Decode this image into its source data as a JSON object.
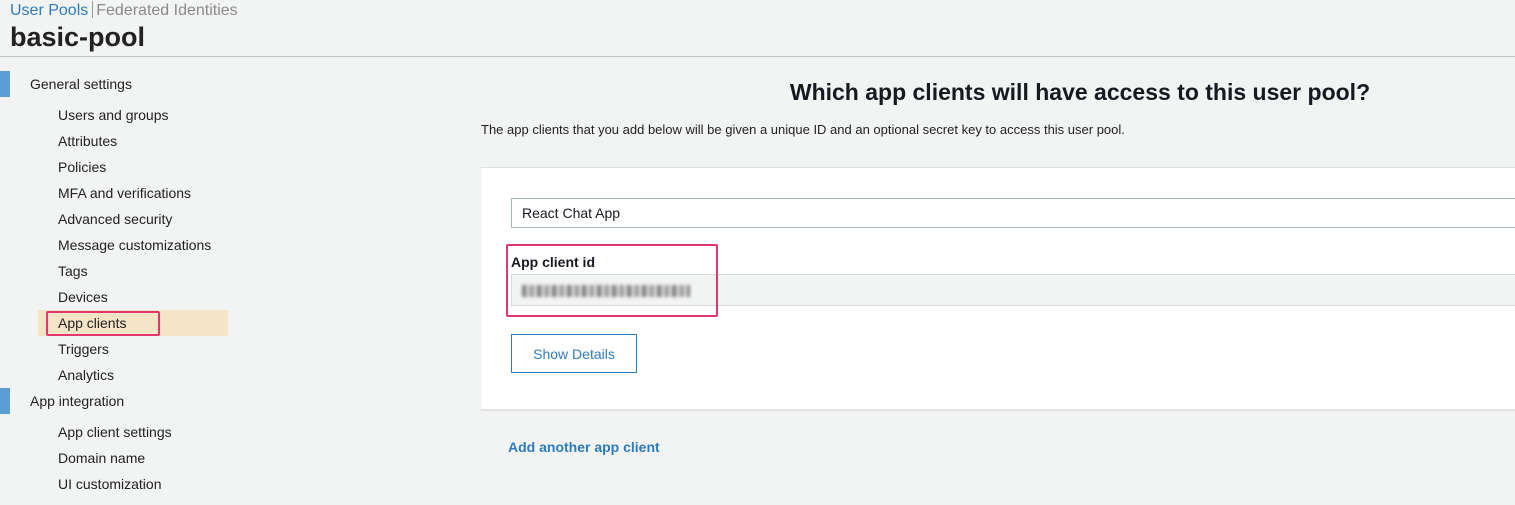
{
  "header": {
    "tabs": [
      "User Pools",
      "Federated Identities"
    ],
    "pool_name": "basic-pool"
  },
  "sidebar": {
    "sections": [
      {
        "label": "General settings",
        "items": [
          "Users and groups",
          "Attributes",
          "Policies",
          "MFA and verifications",
          "Advanced security",
          "Message customizations",
          "Tags",
          "Devices",
          "App clients",
          "Triggers",
          "Analytics"
        ]
      },
      {
        "label": "App integration",
        "items": [
          "App client settings",
          "Domain name",
          "UI customization"
        ]
      }
    ],
    "active_item": "App clients"
  },
  "main": {
    "heading": "Which app clients will have access to this user pool?",
    "description": "The app clients that you add below will be given a unique ID and an optional secret key to access this user pool.",
    "app_client": {
      "name": "React Chat App",
      "id_label": "App client id",
      "show_details_label": "Show Details"
    },
    "add_link": "Add another app client"
  },
  "colors": {
    "link": "#2e7bbf",
    "highlight_border": "#e0386e",
    "active_nav_background": "#f6e4c6",
    "section_marker": "#5a9fd4"
  }
}
